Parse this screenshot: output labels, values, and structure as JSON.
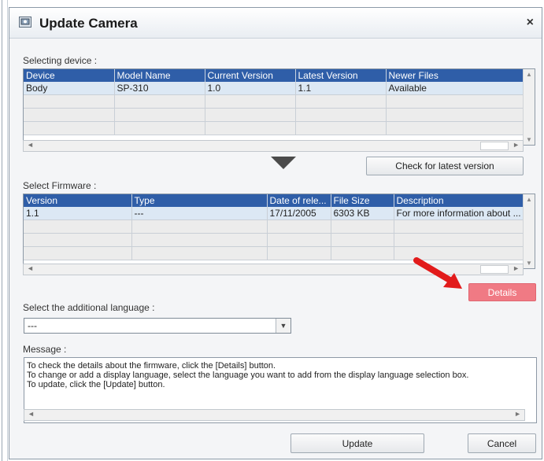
{
  "dialog": {
    "title": "Update Camera",
    "close": "×"
  },
  "device_section": {
    "label": "Selecting device :",
    "columns": [
      "Device",
      "Model Name",
      "Current Version",
      "Latest Version",
      "Newer Files"
    ],
    "rows": [
      [
        "Body",
        "SP-310",
        "1.0",
        "1.1",
        "Available"
      ]
    ]
  },
  "check_button": "Check for latest version",
  "firmware_section": {
    "label": "Select Firmware :",
    "columns": [
      "Version",
      "Type",
      "Date of rele...",
      "File Size",
      "Description"
    ],
    "rows": [
      [
        "1.1",
        "---",
        "17/11/2005",
        "6303 KB",
        "For more information about ..."
      ]
    ]
  },
  "details_button": "Details",
  "language": {
    "label": "Select the additional language :",
    "value": "---"
  },
  "message": {
    "label": "Message :",
    "lines": [
      "To check the details about the firmware, click the [Details] button.",
      "To change or add a display language, select the language you want to add from the display language selection box.",
      "To update, click the [Update] button."
    ]
  },
  "buttons": {
    "update": "Update",
    "cancel": "Cancel"
  },
  "colors": {
    "header": "#2f5ea8",
    "selected_row": "#dce8f4",
    "details_button": "#f07a84",
    "red_arrow": "#e21b1b"
  },
  "icons": [
    "camera-update-icon",
    "close-icon",
    "down-arrow-icon",
    "red-pointer-arrow-icon",
    "dropdown-arrow-icon"
  ]
}
